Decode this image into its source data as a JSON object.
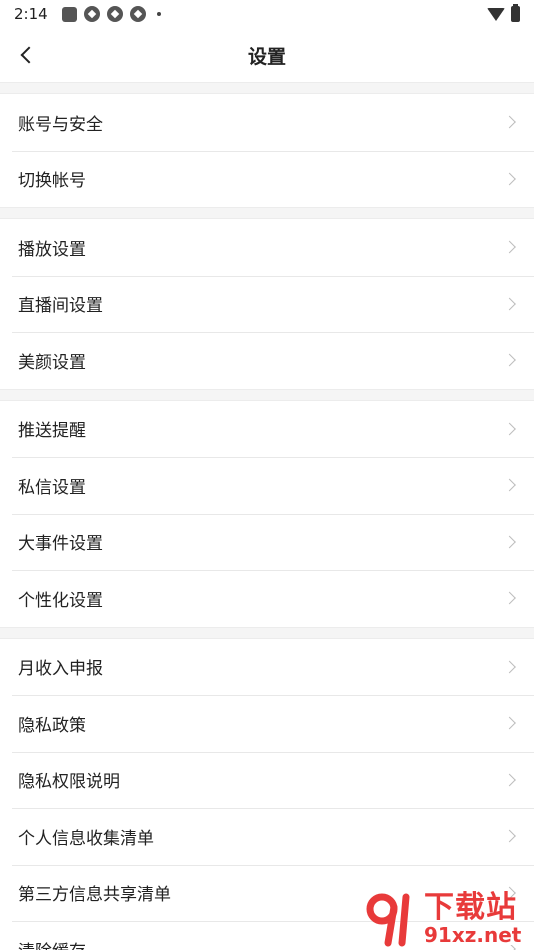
{
  "status_bar": {
    "time": "2:14"
  },
  "nav": {
    "title": "设置"
  },
  "groups": [
    {
      "items": [
        {
          "label": "账号与安全"
        },
        {
          "label": "切换帐号"
        }
      ]
    },
    {
      "items": [
        {
          "label": "播放设置"
        },
        {
          "label": "直播间设置"
        },
        {
          "label": "美颜设置"
        }
      ]
    },
    {
      "items": [
        {
          "label": "推送提醒"
        },
        {
          "label": "私信设置"
        },
        {
          "label": "大事件设置"
        },
        {
          "label": "个性化设置"
        }
      ]
    },
    {
      "items": [
        {
          "label": "月收入申报"
        },
        {
          "label": "隐私政策"
        },
        {
          "label": "隐私权限说明"
        },
        {
          "label": "个人信息收集清单"
        },
        {
          "label": "第三方信息共享清单"
        },
        {
          "label": "清除缓存"
        }
      ]
    }
  ],
  "watermark": {
    "logo_text": "91",
    "brand": "下载站",
    "url": "91xz.net",
    "color": "#e83a3a"
  }
}
